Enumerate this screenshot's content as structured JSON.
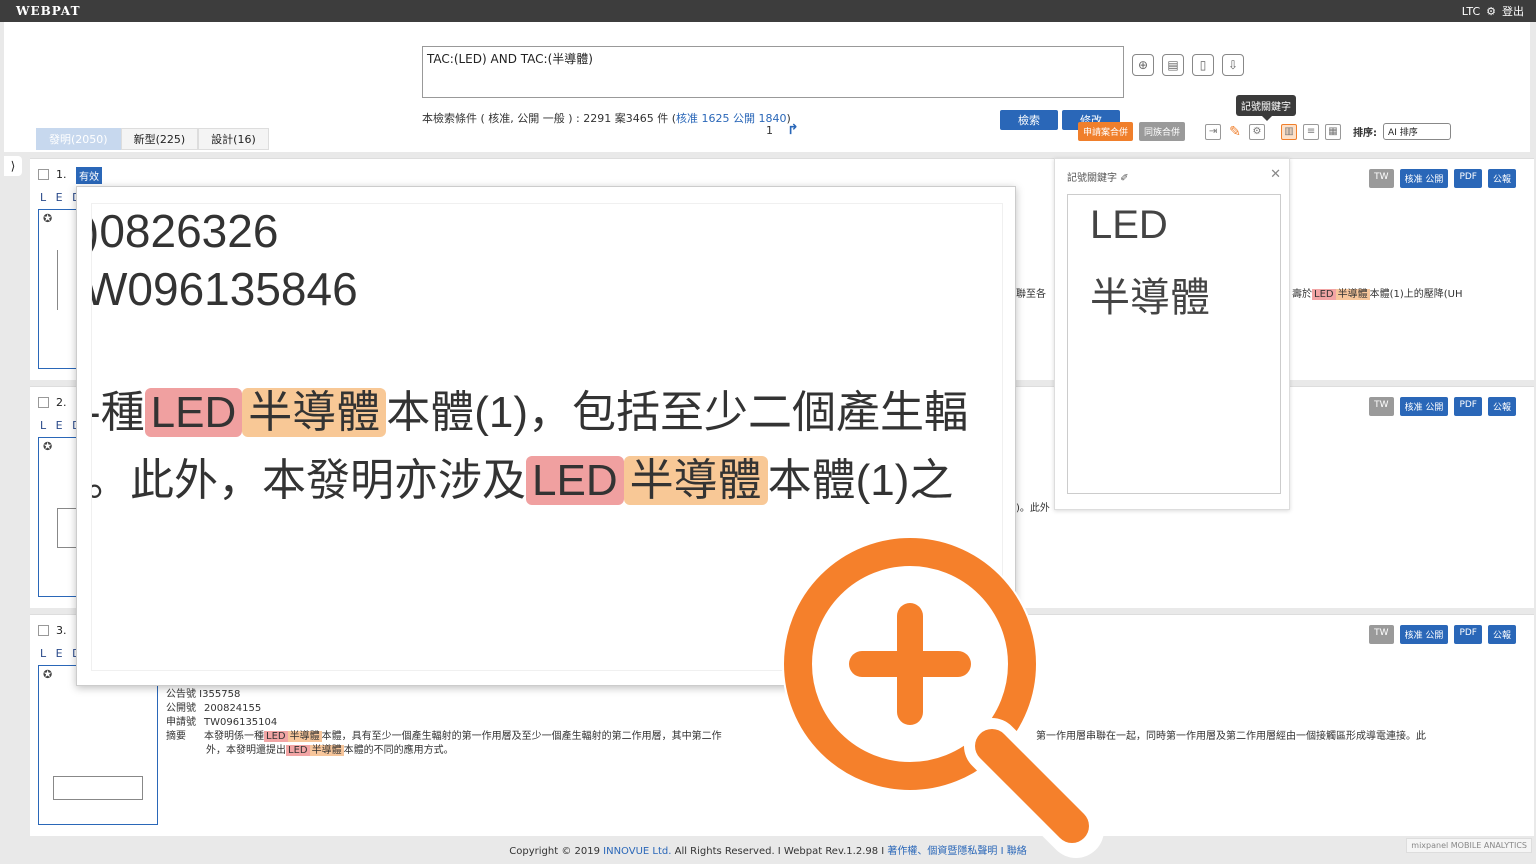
{
  "app": {
    "logo": "WEBPAT",
    "user": "LTC",
    "logout": "登出"
  },
  "search": {
    "query": "TAC:(LED) AND TAC:(半導體)",
    "conditions_prefix": "本檢索條件 ( 核准, 公開 一般 ) : 2291 案3465 件 (",
    "conditions_link": "核准 1625 公開 1840",
    "conditions_suffix": ")",
    "search_button": "檢索",
    "modify_button": "修改"
  },
  "tooltip": "記號關鍵字",
  "tabs": [
    {
      "label": "發明(2050)",
      "active": true
    },
    {
      "label": "新型(225)",
      "active": false
    },
    {
      "label": "設計(16)",
      "active": false
    }
  ],
  "pager": {
    "page": "1"
  },
  "tools": {
    "merge_application": "申請案合併",
    "merge_family": "同族合併",
    "sort_label": "排序:",
    "sort_value": "AI 排序"
  },
  "results": [
    {
      "number": "1.",
      "status": "有效",
      "title": "L E D",
      "buttons": [
        "TW",
        "核准 公開",
        "PDF",
        "公報"
      ],
      "fragment_a": "聯至各",
      "fragment_b_prefix": "壽於",
      "fragment_b_hl1": "LED",
      "fragment_b_hl2": "半導體",
      "fragment_b_suffix": "本體(1)上的壓降(UH"
    },
    {
      "number": "2.",
      "title": "L E D",
      "buttons": [
        "TW",
        "核准 公開",
        "PDF",
        "公報"
      ],
      "fragment_a": ")。此外"
    },
    {
      "number": "3.",
      "title": "L E D",
      "buttons": [
        "TW",
        "核准 公開",
        "PDF",
        "公報"
      ],
      "announce_no": "公告號 I355758",
      "publication_label": "公開號",
      "publication_no": "200824155",
      "application_label": "申請號",
      "application_no": "TW096135104",
      "abstract_label": "摘要",
      "abstract_prefix": "本發明係一種",
      "abstract_hl1": "LED",
      "abstract_hl2": "半導體",
      "abstract_mid": "本體，具有至少一個產生輻射的第一作用層及至少一個產生輻射的第二作用層，其中第二作",
      "abstract_right": "第一作用層串聯在一起，同時第一作用層及第二作用層經由一個接觸區形成導電連接。此",
      "abstract_line2_prefix": "外，本發明還提出",
      "abstract_line2_hl1": "LED",
      "abstract_line2_hl2": "半導體",
      "abstract_line2_suffix": "本體的不同的應用方式。"
    }
  ],
  "zoom": {
    "line1": ")0826326",
    "line2": "W096135846",
    "line3_prefix": "-種",
    "line3_hl1": "LED",
    "line3_hl2": "半導體",
    "line3_suffix": "本體(1)，包括至少二個產生輻",
    "line4_prefix": "。此外，本發明亦涉及",
    "line4_hl1": "LED",
    "line4_hl2": "半導體",
    "line4_suffix": "本體(1)之"
  },
  "keyword_panel": {
    "title": "記號關鍵字",
    "keywords": [
      "LED",
      "半導體"
    ]
  },
  "footer": {
    "prefix": "Copyright © 2019",
    "company": "INNOVUE Ltd.",
    "middle": "All Rights Reserved. I Webpat Rev.1.2.98 I",
    "links": "著作權、個資暨隱私聲明 I 聯絡",
    "badge": "mixpanel MOBILE ANALYTICS"
  },
  "colors": {
    "accent_blue": "#2a67b8",
    "accent_orange": "#f07f2b",
    "highlight_red": "#f2a5a5",
    "highlight_orange": "#f7c69b"
  }
}
